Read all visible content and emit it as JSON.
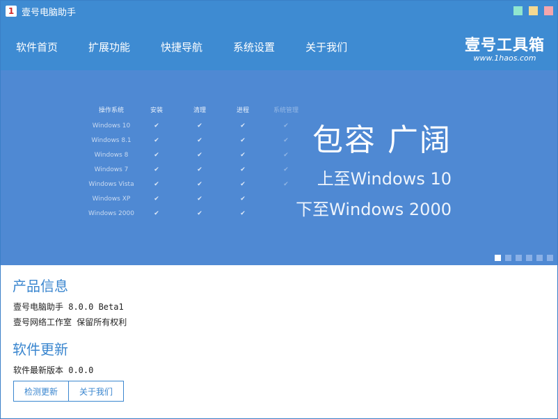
{
  "window": {
    "title": "壹号电脑助手",
    "app_icon_glyph": "1"
  },
  "window_controls": [
    "minimize",
    "maximize",
    "close"
  ],
  "nav": {
    "items": [
      "软件首页",
      "扩展功能",
      "快捷导航",
      "系统设置",
      "关于我们"
    ]
  },
  "brand": {
    "name": "壹号工具箱",
    "subtitle": "www.1haos.com"
  },
  "banner": {
    "table": {
      "headers": [
        "操作系统",
        "安装",
        "清理",
        "进程",
        "系统管理"
      ],
      "rows": [
        {
          "os": "Windows 10",
          "marks": [
            "✔",
            "✔",
            "✔",
            "✔"
          ]
        },
        {
          "os": "Windows 8.1",
          "marks": [
            "✔",
            "✔",
            "✔",
            "✔"
          ]
        },
        {
          "os": "Windows 8",
          "marks": [
            "✔",
            "✔",
            "✔",
            "✔"
          ]
        },
        {
          "os": "Windows 7",
          "marks": [
            "✔",
            "✔",
            "✔",
            "✔"
          ]
        },
        {
          "os": "Windows Vista",
          "marks": [
            "✔",
            "✔",
            "✔",
            "✔"
          ]
        },
        {
          "os": "Windows XP",
          "marks": [
            "✔",
            "✔",
            "✔",
            ""
          ]
        },
        {
          "os": "Windows 2000",
          "marks": [
            "✔",
            "✔",
            "✔",
            ""
          ]
        }
      ]
    },
    "headline": "包容 广阔",
    "line1": "上至Windows 10",
    "line2": "下至Windows 2000",
    "slides": 6,
    "active_slide": 1
  },
  "product_info": {
    "heading": "产品信息",
    "line1": "壹号电脑助手 8.0.0 Beta1",
    "line2": "壹号网络工作室 保留所有权利"
  },
  "update": {
    "heading": "软件更新",
    "latest": "软件最新版本 0.0.0",
    "check_button": "检测更新",
    "about_button": "关于我们"
  },
  "colors": {
    "header": "#3e8bd2",
    "banner": "#4f89d3",
    "accent": "#3a86cf"
  }
}
